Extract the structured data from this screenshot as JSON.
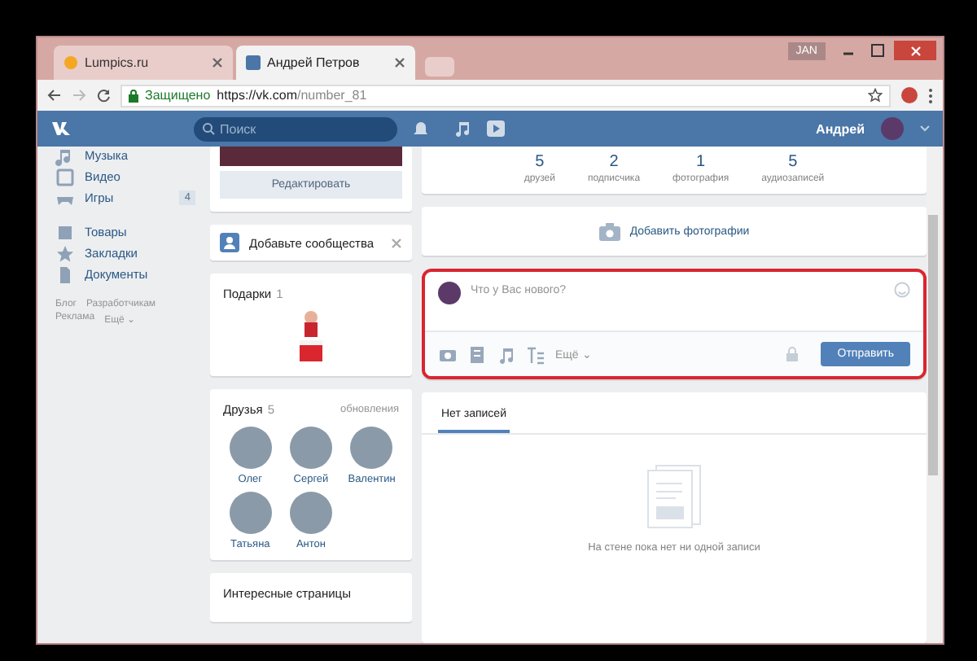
{
  "browser": {
    "tabs": [
      {
        "title": "Lumpics.ru",
        "selected": false
      },
      {
        "title": "Андрей Петров",
        "selected": true
      }
    ],
    "user_badge": "JAN",
    "address": {
      "security": "Защищено",
      "url_host": "https://vk.com",
      "url_path": "/number_81"
    }
  },
  "header": {
    "search": {
      "placeholder": "Поиск"
    },
    "user_name": "Андрей"
  },
  "nav": {
    "groups": [
      [
        {
          "label": "Музыка"
        },
        {
          "label": "Видео"
        },
        {
          "label": "Игры",
          "badge": "4"
        }
      ],
      [
        {
          "label": "Товары"
        },
        {
          "label": "Закладки"
        },
        {
          "label": "Документы"
        }
      ]
    ],
    "footer_links": [
      "Блог",
      "Разработчикам",
      "Реклама",
      "Ещё ⌄"
    ]
  },
  "profile_column": {
    "edit_button": "Редактировать",
    "communities": {
      "label": "Добавьте сообщества"
    },
    "gifts": {
      "title": "Подарки",
      "count": "1"
    },
    "friends": {
      "title": "Друзья",
      "count": "5",
      "link": "обновления",
      "people": [
        {
          "name": "Олег"
        },
        {
          "name": "Сергей"
        },
        {
          "name": "Валентин"
        },
        {
          "name": "Татьяна"
        },
        {
          "name": "Антон"
        }
      ]
    },
    "next_card": {
      "title": "Интересные страницы"
    }
  },
  "main": {
    "stats": [
      {
        "value": "5",
        "label": "друзей"
      },
      {
        "value": "2",
        "label": "подписчика"
      },
      {
        "value": "1",
        "label": "фотография"
      },
      {
        "value": "5",
        "label": "аудиозаписей"
      }
    ],
    "add_photos": "Добавить фотографии",
    "post_box": {
      "placeholder": "Что у Вас нового?",
      "more": "Ещё ⌄",
      "send_button": "Отправить"
    },
    "wall": {
      "tabs": [
        {
          "label": "Нет записей",
          "selected": true
        }
      ],
      "empty_text": "На стене пока нет ни одной записи"
    }
  }
}
